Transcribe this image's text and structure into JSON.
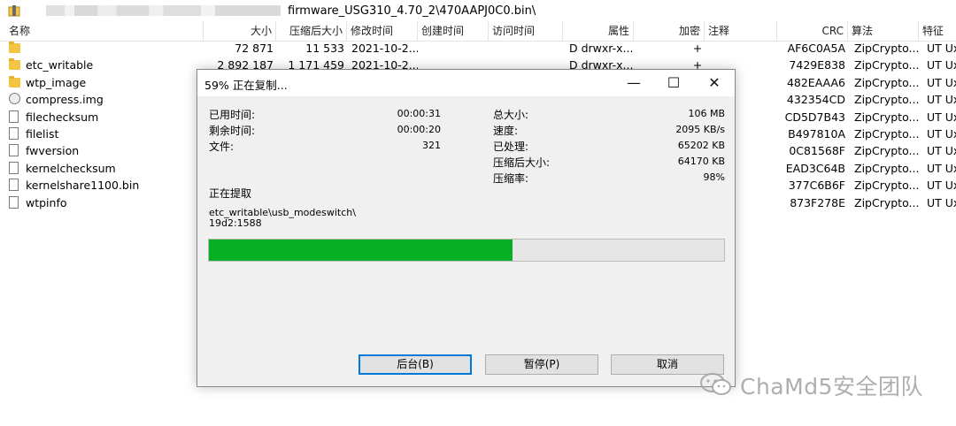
{
  "path": {
    "text": "firmware_USG310_4.70_2\\470AAPJ0C0.bin\\"
  },
  "columns": [
    "名称",
    "大小",
    "压缩后大小",
    "修改时间",
    "创建时间",
    "访问时间",
    "属性",
    "加密",
    "注释",
    "CRC",
    "算法",
    "特征"
  ],
  "rows": [
    {
      "type": "folder",
      "name": "",
      "size": "72 871",
      "packed": "11 533",
      "mtime": "2021-10-2...",
      "attr": "D drwxr-x...",
      "enc": "+",
      "crc": "AF6C0A5A",
      "method": "ZipCrypto...",
      "char": "UT Ux"
    },
    {
      "type": "folder",
      "name": "etc_writable",
      "size": "2 892 187",
      "packed": "1 171 459",
      "mtime": "2021-10-2...",
      "attr": "D drwxr-x...",
      "enc": "+",
      "crc": "7429E838",
      "method": "ZipCrypto...",
      "char": "UT Ux"
    },
    {
      "type": "folder",
      "name": "wtp_image",
      "size": "",
      "packed": "",
      "mtime": "",
      "attr": "",
      "enc": "",
      "crc": "482EAAA6",
      "method": "ZipCrypto...",
      "char": "UT Ux"
    },
    {
      "type": "image",
      "name": "compress.img",
      "size": "",
      "packed": "",
      "mtime": "",
      "attr": "",
      "enc": "",
      "crc": "432354CD",
      "method": "ZipCrypto...",
      "char": "UT Ux"
    },
    {
      "type": "file",
      "name": "filechecksum",
      "size": "",
      "packed": "",
      "mtime": "",
      "attr": "",
      "enc": "",
      "crc": "CD5D7B43",
      "method": "ZipCrypto...",
      "char": "UT Ux"
    },
    {
      "type": "file",
      "name": "filelist",
      "size": "",
      "packed": "",
      "mtime": "",
      "attr": "",
      "enc": "",
      "crc": "B497810A",
      "method": "ZipCrypto...",
      "char": "UT Ux"
    },
    {
      "type": "file",
      "name": "fwversion",
      "size": "",
      "packed": "",
      "mtime": "",
      "attr": "",
      "enc": "",
      "crc": "0C81568F",
      "method": "ZipCrypto...",
      "char": "UT Ux"
    },
    {
      "type": "file",
      "name": "kernelchecksum",
      "size": "",
      "packed": "",
      "mtime": "",
      "attr": "",
      "enc": "",
      "crc": "EAD3C64B",
      "method": "ZipCrypto...",
      "char": "UT Ux"
    },
    {
      "type": "file",
      "name": "kernelshare1100.bin",
      "size": "",
      "packed": "",
      "mtime": "",
      "attr": "",
      "enc": "",
      "crc": "377C6B6F",
      "method": "ZipCrypto...",
      "char": "UT Ux"
    },
    {
      "type": "file",
      "name": "wtpinfo",
      "size": "",
      "packed": "",
      "mtime": "",
      "attr": "",
      "enc": "",
      "crc": "873F278E",
      "method": "ZipCrypto...",
      "char": "UT Ux"
    }
  ],
  "dialog": {
    "title": "59% 正在复制...",
    "elapsed_label": "已用时间:",
    "elapsed": "00:00:31",
    "remaining_label": "剩余时间:",
    "remaining": "00:00:20",
    "files_label": "文件:",
    "files": "321",
    "total_label": "总大小:",
    "total": "106 MB",
    "speed_label": "速度:",
    "speed": "2095 KB/s",
    "processed_label": "已处理:",
    "processed": "65202 KB",
    "compressed_label": "压缩后大小:",
    "compressed": "64170 KB",
    "ratio_label": "压缩率:",
    "ratio": "98%",
    "status": "正在提取",
    "current_path": "etc_writable\\usb_modeswitch\\",
    "current_file": "19d2:1588",
    "progress_percent": 59,
    "btn_background": "后台(B)",
    "btn_pause": "暂停(P)",
    "btn_cancel": "取消"
  },
  "watermark": "ChaMd5安全团队",
  "colors": {
    "progress": "#06b025",
    "accent": "#0078d7"
  }
}
